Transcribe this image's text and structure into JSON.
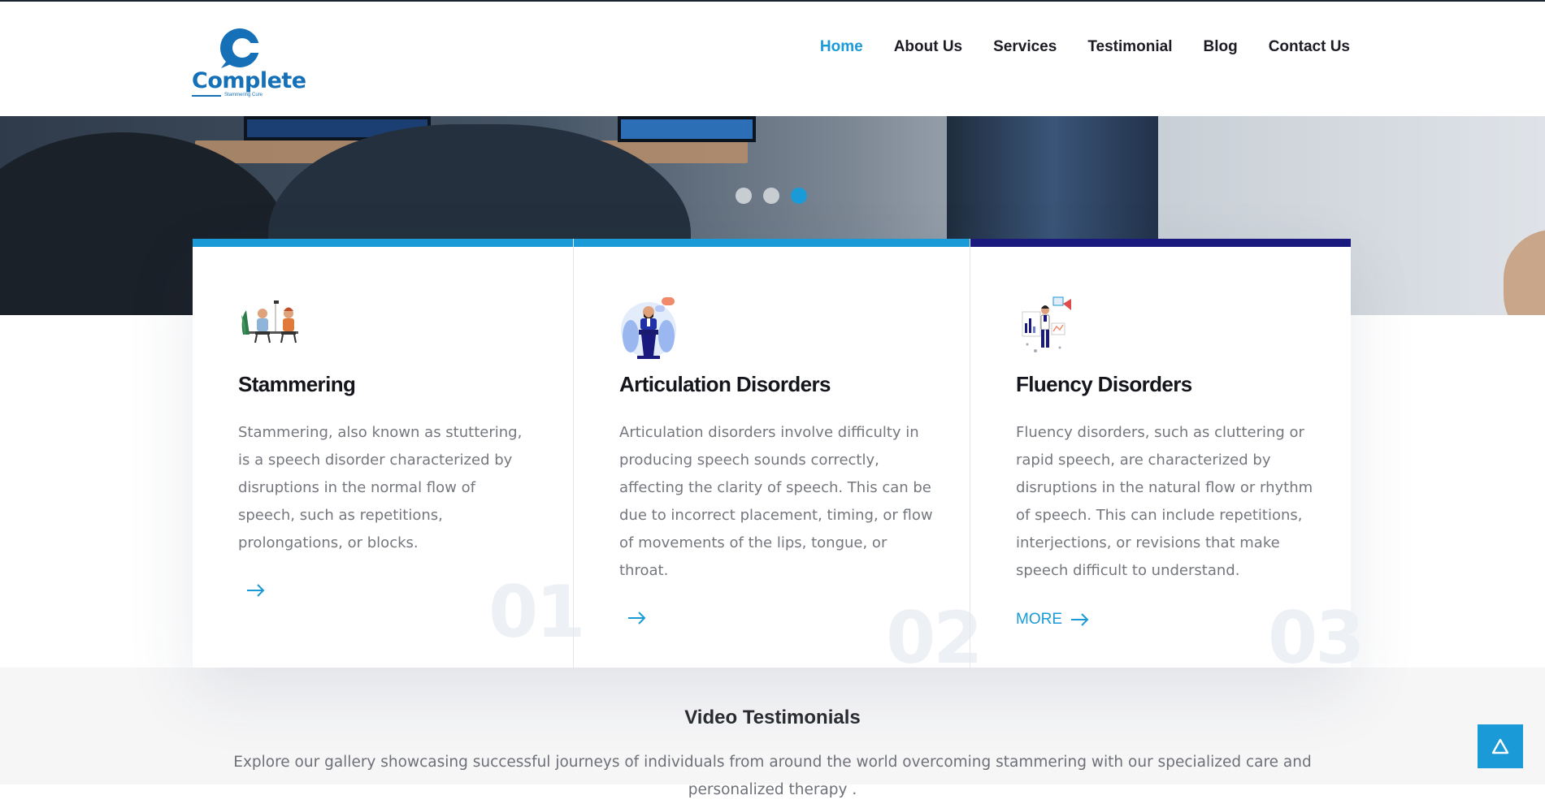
{
  "brand": {
    "name": "Complete",
    "tagline": "Stammering Cure",
    "color": "#1670b8"
  },
  "nav": {
    "items": [
      {
        "label": "Home",
        "active": true
      },
      {
        "label": "About Us",
        "active": false
      },
      {
        "label": "Services",
        "active": false
      },
      {
        "label": "Testimonial",
        "active": false
      },
      {
        "label": "Blog",
        "active": false
      },
      {
        "label": "Contact Us",
        "active": false
      }
    ]
  },
  "slider": {
    "dots": 3,
    "active_index": 3
  },
  "services": [
    {
      "title": "Stammering",
      "text": "Stammering, also known as stuttering, is a speech disorder characterized by disruptions in the normal flow of speech, such as repetitions, prolongations, or blocks.",
      "more_label": "",
      "number": "01",
      "icon": "people-conversation-icon",
      "bar_color": "#1a9ad6"
    },
    {
      "title": "Articulation Disorders",
      "text": "Articulation disorders involve difficulty in producing speech sounds correctly, affecting the clarity of speech. This can be due to incorrect placement, timing, or flow of movements of the lips, tongue, or throat.",
      "more_label": "",
      "number": "02",
      "icon": "speaker-podium-icon",
      "bar_color": "#1a9ad6"
    },
    {
      "title": "Fluency Disorders",
      "text": "Fluency disorders, such as cluttering or rapid speech, are characterized by disruptions in the natural flow or rhythm of speech. This can include repetitions, interjections, or revisions that make speech difficult to understand.",
      "more_label": "MORE",
      "number": "03",
      "icon": "presenter-chart-icon",
      "bar_color": "#1a1a7e"
    }
  ],
  "testimonials": {
    "title": "Video Testimonials",
    "text": "Explore our gallery showcasing successful journeys of individuals from around the world overcoming stammering with our specialized care and personalized therapy ."
  },
  "colors": {
    "accent": "#1a9ad6",
    "dark_accent": "#1a1a7e"
  }
}
